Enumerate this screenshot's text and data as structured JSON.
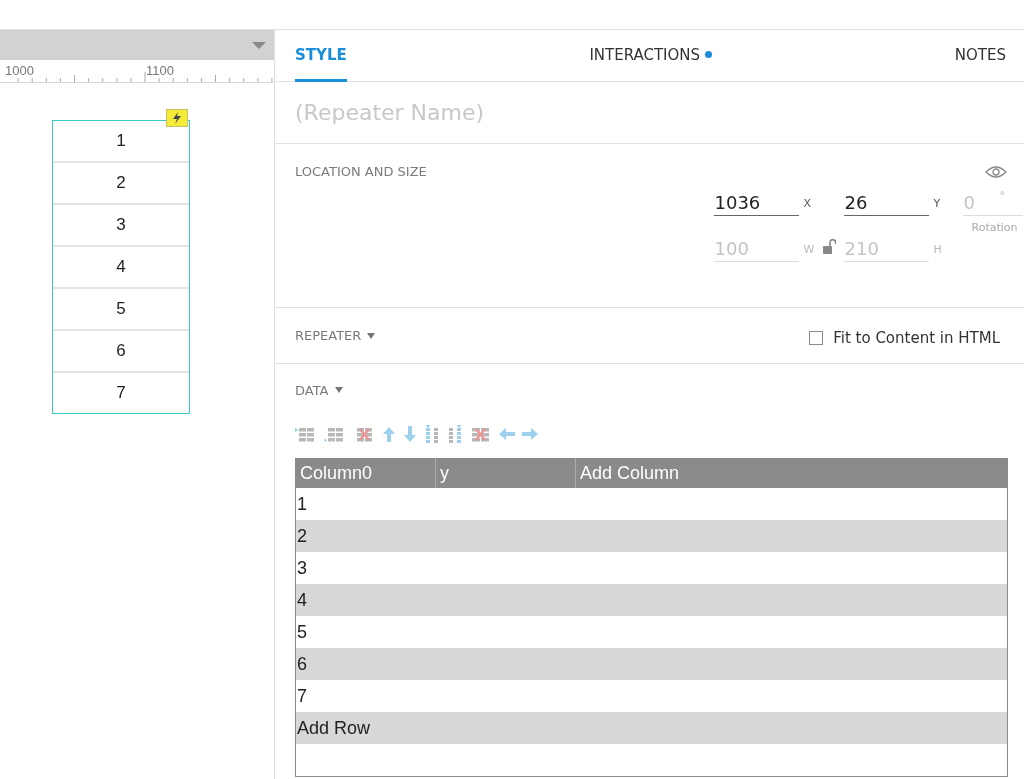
{
  "canvas": {
    "ruler_labels": [
      "1000",
      "1100"
    ],
    "repeater_items": [
      "1",
      "2",
      "3",
      "4",
      "5",
      "6",
      "7"
    ]
  },
  "tabs": [
    {
      "label": "STYLE",
      "selected": true,
      "dot": false
    },
    {
      "label": "INTERACTIONS",
      "selected": false,
      "dot": true
    },
    {
      "label": "NOTES",
      "selected": false,
      "dot": false
    }
  ],
  "name_field": {
    "placeholder": "(Repeater Name)"
  },
  "location_section": {
    "title": "LOCATION AND SIZE",
    "fields": [
      {
        "value": "1036",
        "unit": "X",
        "disabled": false
      },
      {
        "value": "26",
        "unit": "Y",
        "disabled": false
      },
      {
        "value": "0",
        "unit": "°",
        "disabled": true,
        "caption": "Rotation"
      },
      {
        "value": "100",
        "unit": "W",
        "disabled": true
      },
      {
        "value": "210",
        "unit": "H",
        "disabled": true
      }
    ]
  },
  "repeater_section": {
    "title": "REPEATER",
    "fit_to_content": {
      "label": "Fit to Content in HTML",
      "checked": false
    }
  },
  "data_section": {
    "title": "DATA",
    "table": {
      "columns": [
        "Column0",
        "y",
        "Add Column"
      ],
      "rows": [
        "1",
        "2",
        "3",
        "4",
        "5",
        "6",
        "7",
        "Add Row"
      ]
    }
  }
}
